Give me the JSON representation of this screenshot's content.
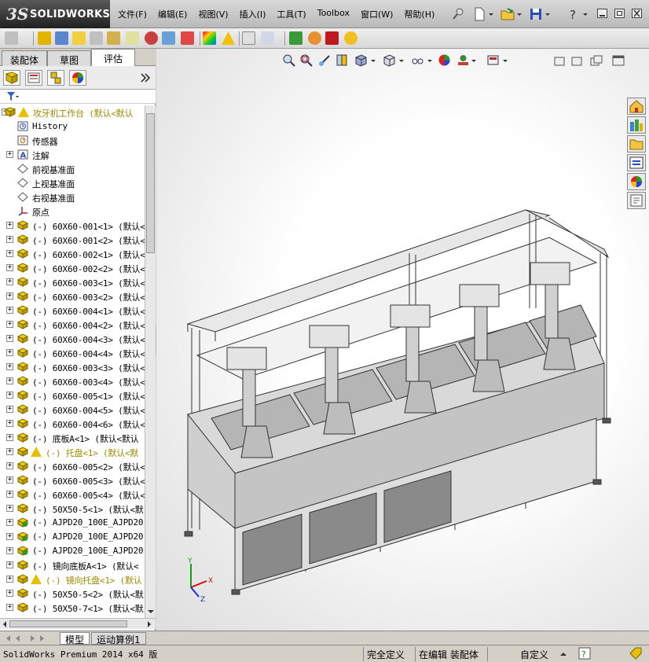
{
  "app": {
    "brand_ds": "3S",
    "brand_name": "SOLIDWORKS"
  },
  "menu": [
    "文件(F)",
    "编辑(E)",
    "视图(V)",
    "插入(I)",
    "工具(T)",
    "Toolbox",
    "窗口(W)",
    "帮助(H)"
  ],
  "left_tabs": [
    "装配体",
    "草图",
    "评估"
  ],
  "active_tab": "评估",
  "tree": [
    {
      "label": "攻牙机工作台  (默认<默认",
      "icon": "assembly-icon",
      "warning": true,
      "yellow": true,
      "expand": "−",
      "indent": 0
    },
    {
      "label": "History",
      "icon": "history-icon",
      "indent": 1
    },
    {
      "label": "传感器",
      "icon": "sensor-icon",
      "indent": 1
    },
    {
      "label": "注解",
      "icon": "annotation-icon",
      "expand": "+",
      "indent": 1
    },
    {
      "label": "前视基准面",
      "icon": "plane-icon",
      "indent": 1
    },
    {
      "label": "上视基准面",
      "icon": "plane-icon",
      "indent": 1
    },
    {
      "label": "右视基准面",
      "icon": "plane-icon",
      "indent": 1
    },
    {
      "label": "原点",
      "icon": "origin-icon",
      "indent": 1
    },
    {
      "label": "(-) 60X60-001<1> (默认<",
      "icon": "part-icon",
      "expand": "+",
      "indent": 1
    },
    {
      "label": "(-) 60X60-001<2> (默认<",
      "icon": "part-icon",
      "expand": "+",
      "indent": 1
    },
    {
      "label": "(-) 60X60-002<1> (默认<",
      "icon": "part-icon",
      "expand": "+",
      "indent": 1
    },
    {
      "label": "(-) 60X60-002<2> (默认<",
      "icon": "part-icon",
      "expand": "+",
      "indent": 1
    },
    {
      "label": "(-) 60X60-003<1> (默认<",
      "icon": "part-icon",
      "expand": "+",
      "indent": 1
    },
    {
      "label": "(-) 60X60-003<2> (默认<",
      "icon": "part-icon",
      "expand": "+",
      "indent": 1
    },
    {
      "label": "(-) 60X60-004<1> (默认<",
      "icon": "part-icon",
      "expand": "+",
      "indent": 1
    },
    {
      "label": "(-) 60X60-004<2> (默认<",
      "icon": "part-icon",
      "expand": "+",
      "indent": 1
    },
    {
      "label": "(-) 60X60-004<3> (默认<",
      "icon": "part-icon",
      "expand": "+",
      "indent": 1
    },
    {
      "label": "(-) 60X60-004<4> (默认<",
      "icon": "part-icon",
      "expand": "+",
      "indent": 1
    },
    {
      "label": "(-) 60X60-003<3> (默认<",
      "icon": "part-icon",
      "expand": "+",
      "indent": 1
    },
    {
      "label": "(-) 60X60-003<4> (默认<",
      "icon": "part-icon",
      "expand": "+",
      "indent": 1
    },
    {
      "label": "(-) 60X60-005<1> (默认<",
      "icon": "part-icon",
      "expand": "+",
      "indent": 1
    },
    {
      "label": "(-) 60X60-004<5> (默认<",
      "icon": "part-icon",
      "expand": "+",
      "indent": 1
    },
    {
      "label": "(-) 60X60-004<6> (默认<",
      "icon": "part-icon",
      "expand": "+",
      "indent": 1
    },
    {
      "label": "(-) 底板A<1> (默认<默认",
      "icon": "part-icon",
      "expand": "+",
      "indent": 1
    },
    {
      "label": "(-) 托盘<1> (默认<默",
      "icon": "part-icon",
      "warning": true,
      "yellow": true,
      "expand": "+",
      "indent": 1
    },
    {
      "label": "(-) 60X60-005<2> (默认<",
      "icon": "part-icon",
      "expand": "+",
      "indent": 1
    },
    {
      "label": "(-) 60X60-005<3> (默认<",
      "icon": "part-icon",
      "expand": "+",
      "indent": 1
    },
    {
      "label": "(-) 60X60-005<4> (默认<",
      "icon": "part-icon",
      "expand": "+",
      "indent": 1
    },
    {
      "label": "(-) 50X50-5<1> (默认<默",
      "icon": "part-icon",
      "expand": "+",
      "indent": 1
    },
    {
      "label": "(-) AJPD20_100E_AJPD20-",
      "icon": "subassembly-icon",
      "expand": "+",
      "indent": 1
    },
    {
      "label": "(-) AJPD20_100E_AJPD20-",
      "icon": "subassembly-icon",
      "expand": "+",
      "indent": 1
    },
    {
      "label": "(-) AJPD20_100E_AJPD20-",
      "icon": "subassembly-icon",
      "expand": "+",
      "indent": 1
    },
    {
      "label": "(-) 镜向底板A<1> (默认<",
      "icon": "part-icon",
      "expand": "+",
      "indent": 1
    },
    {
      "label": "(-) 镜向托盘<1> (默认",
      "icon": "part-icon",
      "warning": true,
      "yellow": true,
      "expand": "+",
      "indent": 1
    },
    {
      "label": "(-) 50X50-5<2> (默认<默",
      "icon": "part-icon",
      "expand": "+",
      "indent": 1
    },
    {
      "label": "(-) 50X50-7<1> (默认<默",
      "icon": "part-icon",
      "expand": "+",
      "indent": 1
    }
  ],
  "bottom_tabs": [
    "模型",
    "运动算例1"
  ],
  "status": {
    "product": "SolidWorks Premium 2014 x64 版",
    "state1": "完全定义",
    "state2": "在编辑 装配体",
    "state3": "自定义"
  },
  "triad": {
    "x": "X",
    "y": "Y",
    "z": "Z"
  },
  "colors": {
    "part_yellow": "#e6c200",
    "warning": "#e8c000",
    "axis_x": "#d01010",
    "axis_y": "#10a010",
    "axis_z": "#1030d0"
  }
}
